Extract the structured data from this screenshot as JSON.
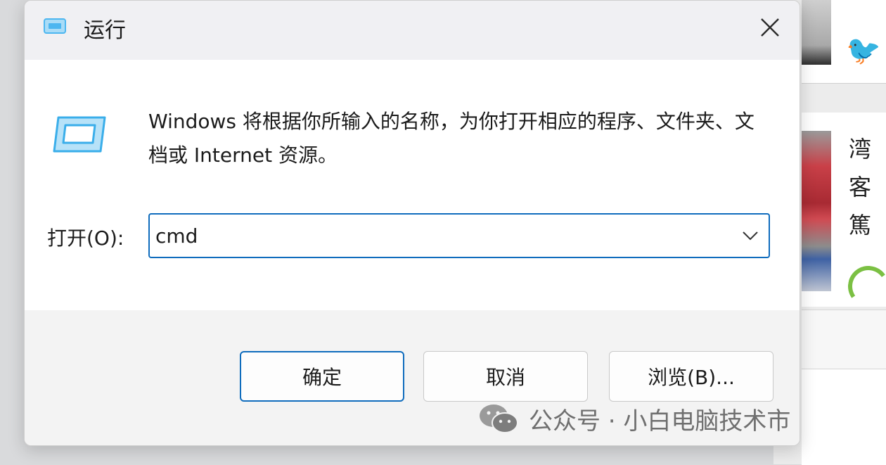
{
  "dialog": {
    "title": "运行",
    "description": "Windows 将根据你所输入的名称，为你打开相应的程序、文件夹、文档或 Internet 资源。",
    "open_label": "打开(O):",
    "open_value": "cmd",
    "buttons": {
      "ok": "确定",
      "cancel": "取消",
      "browse": "浏览(B)..."
    }
  },
  "background": {
    "snippets": [
      "湾",
      "客",
      "篤"
    ]
  },
  "watermark": {
    "text": "公众号 · 小白电脑技术市"
  },
  "icons": {
    "title": "run-icon",
    "dialog": "run-icon",
    "close": "close-icon",
    "dropdown": "chevron-down-icon",
    "watermark": "wechat-logo"
  },
  "colors": {
    "accent": "#0f6cbd",
    "icon_blue": "#4cb6f0"
  }
}
